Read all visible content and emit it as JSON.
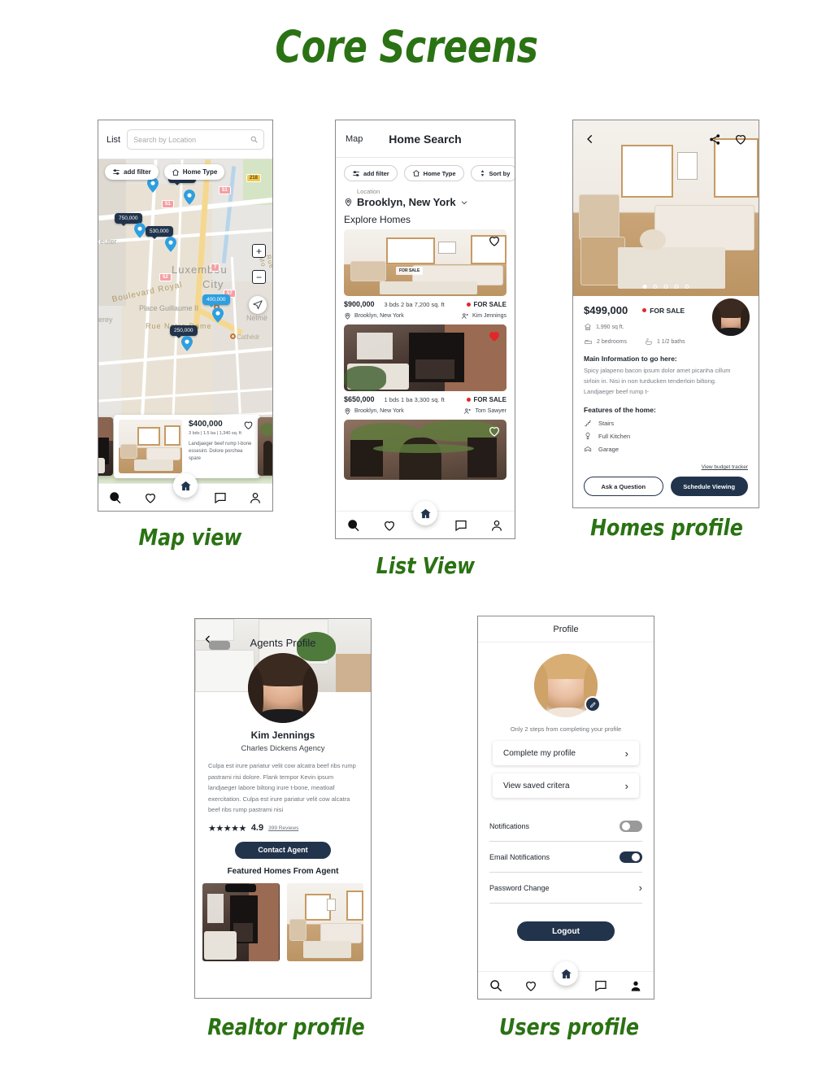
{
  "title": "Core Screens",
  "captions": {
    "map_view": "Map view",
    "list_view": "List View",
    "homes_profile": "Homes profile",
    "realtor_profile": "Realtor profile",
    "users_profile": "Users profile"
  },
  "accent": {
    "navy": "#22344c",
    "green": "#2a7213",
    "red": "#e3262b",
    "blue": "#2e9fe0"
  },
  "map_screen": {
    "list_tab": "List",
    "search_placeholder": "Search by Location",
    "chips": {
      "add_filter": "add filter",
      "home_type": "Home Type"
    },
    "markers": [
      {
        "price": "750,000",
        "style": "dark"
      },
      {
        "price": "750,000",
        "style": "dark"
      },
      {
        "price": "530,000",
        "style": "dark"
      },
      {
        "price": "400,000",
        "style": "blue"
      },
      {
        "price": "250,000",
        "style": "dark"
      }
    ],
    "map_labels": {
      "city": "Luxembou",
      "city2": "City",
      "place": "Place Guillaume II",
      "street1": "Boulevard Royal",
      "street2": "Rue Notre Dame",
      "street3": "Rue Mo",
      "left1": "euter",
      "left2": "erey",
      "right1": "Neimë",
      "right2": "Cathédr"
    },
    "shields": [
      "218",
      "51",
      "51",
      "52",
      "7",
      "57"
    ],
    "zoom_in": "+",
    "zoom_out": "−",
    "card": {
      "price": "$400,000",
      "specs": "3 bds | 1.5 ba | 1,340 sq. ft",
      "description": "Landjaeger beef rump t-bone essesint. Dolore porchea spare"
    }
  },
  "list_screen": {
    "map_tab": "Map",
    "title": "Home Search",
    "chips": {
      "add_filter": "add filter",
      "home_type": "Home Type",
      "sort_by": "Sort by"
    },
    "location_label": "Location",
    "location_value": "Brooklyn, New York",
    "section_title": "Explore Homes",
    "listings": [
      {
        "price": "$900,000",
        "specs": "3 bds  2 ba  7,200 sq. ft",
        "status": "FOR SALE",
        "location": "Brooklyn, New York",
        "agent": "Kim Jennings",
        "favorited": false,
        "tag": "FOR SALE"
      },
      {
        "price": "$650,000",
        "specs": "1 bds  1 ba  3,300 sq. ft",
        "status": "FOR SALE",
        "location": "Brooklyn, New York",
        "agent": "Tom Sawyer",
        "favorited": true,
        "tag": ""
      },
      {
        "price": "",
        "specs": "",
        "status": "",
        "location": "",
        "agent": "",
        "favorited": false,
        "tag": ""
      }
    ]
  },
  "home_profile": {
    "price": "$499,000",
    "status": "FOR SALE",
    "sqft": "1,990 sq ft.",
    "bedrooms": "2 bedrooms",
    "baths": "1 1/2 baths",
    "info_heading": "Main Information to go here:",
    "info_body": "Spicy jalapeno bacon ipsum dolor amet picanha cillum sirloin in. Nisi in non turducken tenderloin biltong. Landjaeger beef rump t-",
    "features_heading": "Features of the home:",
    "features": [
      "Stairs",
      "Full Kitchen",
      "Garage"
    ],
    "budget_link": "View budget tracker",
    "btn_secondary": "Ask a Question",
    "btn_primary": "Schedule Viewing",
    "carousel_dots": 5,
    "carousel_active": 0
  },
  "realtor_profile": {
    "header_title": "Agents Profile",
    "name": "Kim Jennings",
    "agency": "Charles Dickens Agency",
    "bio": "Culpa est irure pariatur velit cow alcatra beef ribs rump pastrami risi dolore. Flank tempor Kevin ipsum landjaeger labore biltong irure t-bone, meatloaf exercitation. Culpa est irure pariatur velit cow alcatra beef ribs rump pastrami nisi",
    "stars": "★★★★★",
    "rating": "4.9",
    "reviews": "399 Reviews",
    "contact_button": "Contact Agent",
    "featured_heading": "Featured Homes From Agent"
  },
  "user_profile": {
    "header_title": "Profile",
    "note": "Only 2 steps from completing your profile",
    "actions": [
      {
        "label": "Complete my profile"
      },
      {
        "label": "View saved critera"
      }
    ],
    "settings": [
      {
        "label": "Notifications",
        "type": "toggle",
        "value": "off"
      },
      {
        "label": "Email Notifications",
        "type": "toggle",
        "value": "on"
      },
      {
        "label": "Password Change",
        "type": "chevron",
        "value": ""
      }
    ],
    "logout": "Logout"
  },
  "icons": {
    "search": "search-icon",
    "heart": "heart-icon",
    "home": "home-icon",
    "chat": "chat-icon",
    "person": "person-icon",
    "share": "share-icon",
    "back": "back-chevron-icon",
    "chevron_right": "›",
    "chevron_down": "∨"
  }
}
